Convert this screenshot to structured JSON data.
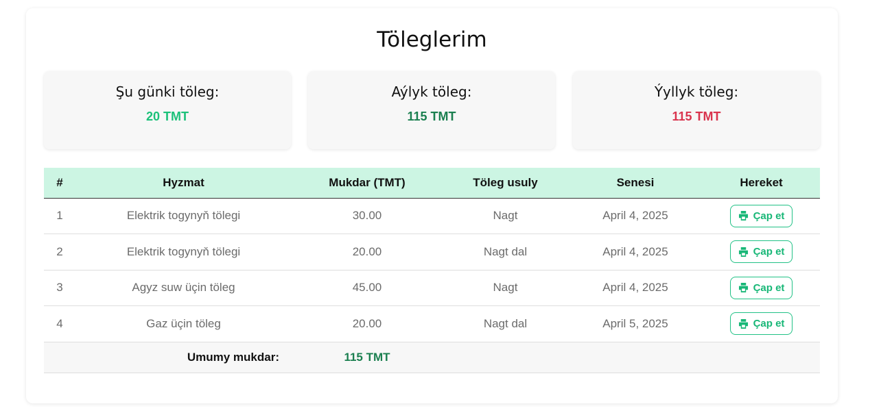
{
  "page": {
    "title": "Töleglerim"
  },
  "summary": [
    {
      "label": "Şu günki töleg:",
      "value": "20 TMT",
      "color": "#1cc17a"
    },
    {
      "label": "Aýlyk töleg:",
      "value": "115 TMT",
      "color": "#1a7f4f"
    },
    {
      "label": "Ýyllyk töleg:",
      "value": "115 TMT",
      "color": "#d9334d"
    }
  ],
  "table": {
    "headers": [
      "#",
      "Hyzmat",
      "Mukdar (TMT)",
      "Töleg usuly",
      "Senesi",
      "Hereket"
    ],
    "rows": [
      {
        "num": "1",
        "service": "Elektrik togynyň tölegi",
        "amount": "30.00",
        "method": "Nagt",
        "date": "April 4, 2025",
        "action": "Çap et"
      },
      {
        "num": "2",
        "service": "Elektrik togynyň tölegi",
        "amount": "20.00",
        "method": "Nagt dal",
        "date": "April 4, 2025",
        "action": "Çap et"
      },
      {
        "num": "3",
        "service": "Agyz suw üçin töleg",
        "amount": "45.00",
        "method": "Nagt",
        "date": "April 4, 2025",
        "action": "Çap et"
      },
      {
        "num": "4",
        "service": "Gaz üçin töleg",
        "amount": "20.00",
        "method": "Nagt dal",
        "date": "April 5, 2025",
        "action": "Çap et"
      }
    ],
    "total": {
      "label": "Umumy mukdar:",
      "value": "115 TMT",
      "color": "#1a7f4f"
    }
  },
  "icons": {
    "print": "printer-icon"
  },
  "colors": {
    "accent": "#20c185",
    "header_bg": "#ccf5e3"
  }
}
